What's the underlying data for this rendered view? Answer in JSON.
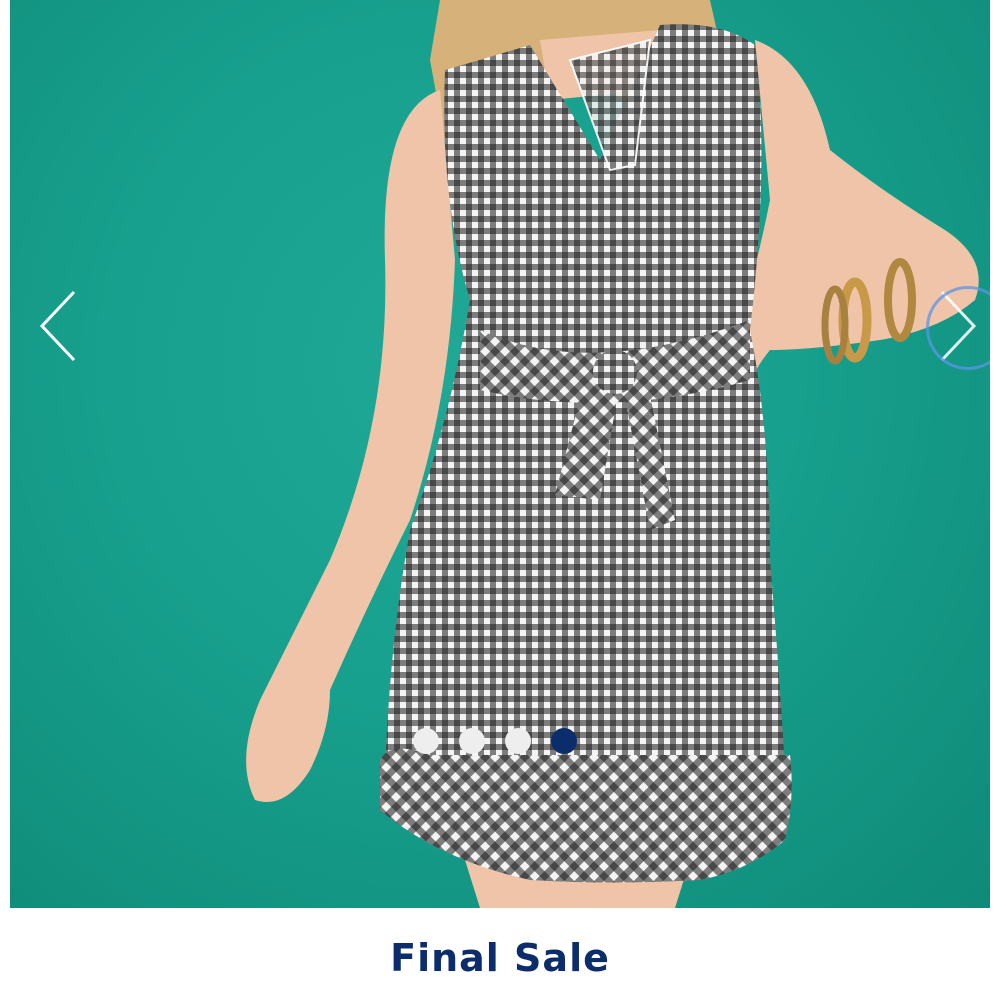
{
  "carousel": {
    "prev_icon": "chevron-left-icon",
    "next_icon": "chevron-right-icon",
    "slide_count": 4,
    "active_slide": 4,
    "colors": {
      "background": "#17a08d",
      "active_dot": "#0c2d6b",
      "inactive_dot": "#eeeeee",
      "focus_ring": "#5a96e6"
    }
  },
  "product": {
    "badge_text": "Final Sale",
    "badge_color": "#0c2d6b"
  }
}
